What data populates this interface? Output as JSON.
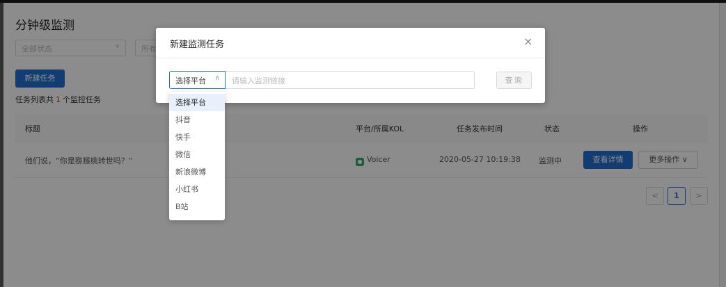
{
  "page": {
    "title": "分钟级监测",
    "filters": [
      {
        "label": "全部状态"
      },
      {
        "label": "所有"
      }
    ],
    "new_task_label": "新建任务",
    "task_count": {
      "prefix": "任务列表共",
      "count": "1",
      "suffix": "个监控任务"
    }
  },
  "table": {
    "headers": {
      "title": "标题",
      "platform": "平台/所属KOL",
      "publish_time": "任务发布时间",
      "status": "状态",
      "actions": "操作"
    },
    "rows": [
      {
        "title": "他们说，“你是猕猴桃转世吗？”",
        "platform_kol": "Voicer",
        "publish_time": "2020-05-27 10:19:38",
        "status": "监测中",
        "detail_label": "查看详情",
        "more_label": "更多操作"
      }
    ]
  },
  "pagination": {
    "prev": "<",
    "current": "1",
    "next": ">"
  },
  "modal": {
    "title": "新建监测任务",
    "close": "×",
    "platform_select": {
      "value": "选择平台"
    },
    "link_input": {
      "placeholder": "请输入监测链接"
    },
    "query_label": "查询"
  },
  "dropdown": {
    "options": [
      "选择平台",
      "抖音",
      "快手",
      "微信",
      "新浪微博",
      "小红书",
      "B站"
    ],
    "selected_index": 0
  },
  "colors": {
    "primary": "#1f6fd1",
    "count_highlight": "#e02020",
    "wechat_green": "#2aae67",
    "overlay": "rgba(0,0,0,0.45)"
  }
}
